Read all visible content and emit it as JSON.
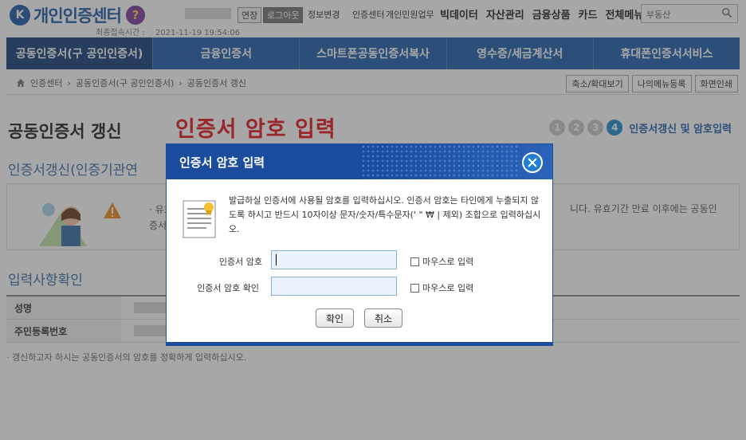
{
  "header": {
    "logo_text": "개인인증센터",
    "logo_mark": "K",
    "help_icon": "?",
    "last_login_label": "최종접속시간 :",
    "last_login_time": "2021-11-19 19:54:06",
    "extend_label": "연장",
    "logout_label": "로그아웃",
    "info_change_label": "정보변경",
    "links": [
      "인증센터",
      "개인민원업무"
    ],
    "gnb": [
      "빅데이터",
      "자산관리",
      "금융상품",
      "카드",
      "전체메뉴"
    ],
    "search_value": "부동산"
  },
  "mainnav": [
    "공동인증서(구 공인인증서)",
    "금융인증서",
    "스마트폰공동인증서복사",
    "영수증/세금계산서",
    "휴대폰인증서서비스"
  ],
  "breadcrumb": [
    "인증센터",
    "공동인증서(구 공인인증서)",
    "공동인증서 갱신"
  ],
  "util_buttons": [
    "축소/확대보기",
    "나의메뉴등록",
    "화면인쇄"
  ],
  "page": {
    "title": "공동인증서 갱신",
    "caption": "인증서 암호 입력",
    "steps": [
      "1",
      "2",
      "3",
      "4"
    ],
    "step_label": "인증서갱신 및 암호입력",
    "section1_title": "인증서갱신(인증기관연",
    "info_text_prefix": "· 유효",
    "info_text_line2": "증서",
    "info_text_right": "니다. 유효기간 만료 이후에는 공동인",
    "section2_title": "입력사항확인",
    "table_rows": [
      {
        "label": "성명"
      },
      {
        "label": "주민등록번호"
      }
    ],
    "note": "· 갱신하고자 하시는 공동인증서의 암호를 정확하게 입력하십시오."
  },
  "modal": {
    "title": "인증서 암호 입력",
    "description": "발급하실 인증서에 사용될 암호를 입력하십시오. 인증서 암호는 타인에게 누출되지 않도록 하시고 반드시 10자이상 문자/숫자/특수문자(' \" ₩ | 제외) 조합으로 입력하십시오.",
    "password_label": "인증서 암호",
    "confirm_label": "인증서 암호 확인",
    "password_value": "",
    "confirm_value": "",
    "mouse_input_label": "마우스로 입력",
    "ok_label": "확인",
    "cancel_label": "취소"
  },
  "colors": {
    "brand_blue": "#1f5fae",
    "caption_red": "#e3141c",
    "modal_header": "#1c4c9e"
  }
}
